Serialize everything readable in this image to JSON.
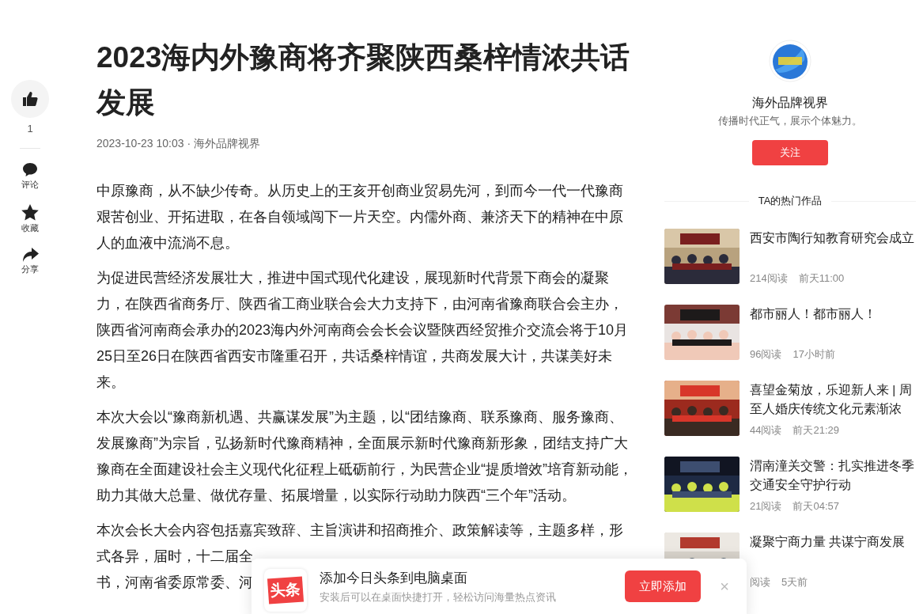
{
  "action_bar": {
    "like": {
      "count": "1"
    },
    "items": [
      {
        "kind": "comment",
        "label": "评论"
      },
      {
        "kind": "favorite",
        "label": "收藏"
      },
      {
        "kind": "share",
        "label": "分享"
      }
    ]
  },
  "article": {
    "title": "2023海内外豫商将齐聚陕西桑梓情浓共话发展",
    "meta": "2023-10-23 10:03 · 海外品牌视界",
    "paragraphs": [
      {
        "lines": [
          "中原豫商，从不缺少传奇。从历史上的王亥开创商业贸易先河，到而今一代一代豫商艰苦创业、开拓进取，在各自领域闯下一片天空。内儒外商、兼济天下的精神在中原人的血液中流淌不息。"
        ]
      },
      {
        "lines": [
          "为促进民营经济发展壮大，推进中国式现代化建设，展现新时代背景下商会的凝聚力，在陕西省商务厅、陕西省工商业联合会大力支持下，由河南省豫商联合会主办，陕西省河南商会承办的2023海内外河南商会会长会议暨陕西经贸推介交流会将于10月25日至26日在陕西省西安市隆重召开，共话桑梓情谊，共商发展大计，共谋美好未来。"
        ]
      },
      {
        "lines": [
          "本次大会以“豫商新机遇、共赢谋发展”为主题，以“团结豫商、联系豫商、服务豫商、发展豫商”为宗旨，弘扬新时代豫商精神，全面展示新时代豫商新形象，团结支持广大豫商在全面建设社会主义现代化征程上砥砺前行，为民营企业“提质增效”培育新动能，助力其做大总量、做优存量、拓展增量，以实际行动助力陕西“三个年”活动。"
        ]
      },
      {
        "lines": [
          "本次会长大会内容包括嘉宾致辞、主旨演讲和招商推介、政策解读等，主题多样，形",
          "式各异，届时，十二届全",
          "书，河南省委原常委、河"
        ]
      }
    ]
  },
  "author": {
    "name": "海外品牌视界",
    "motto": "传播时代正气，展示个体魅力。",
    "follow_button": "关注"
  },
  "hot_works": {
    "heading": "TA的热门作品",
    "items": [
      {
        "title": "西安市陶行知教育研究会成立",
        "reads": "214阅读",
        "time": "前天11:00"
      },
      {
        "title": "都市丽人！都市丽人！",
        "reads": "96阅读",
        "time": "17小时前"
      },
      {
        "title": "喜望金菊放，乐迎新人来 | 周至人婚庆传统文化元素渐浓",
        "reads": "44阅读",
        "time": "前天21:29"
      },
      {
        "title": "渭南潼关交警：扎实推进冬季交通安全守护行动",
        "reads": "21阅读",
        "time": "前天04:57"
      },
      {
        "title": "凝聚宁商力量 共谋宁商发展",
        "reads": "阅读",
        "time": "5天前"
      }
    ]
  },
  "install_prompt": {
    "logo_text": "头条",
    "title": "添加今日头条到电脑桌面",
    "subtitle": "安装后可以在桌面快捷打开，轻松访问海量热点资讯",
    "button": "立即添加",
    "close": "×"
  }
}
